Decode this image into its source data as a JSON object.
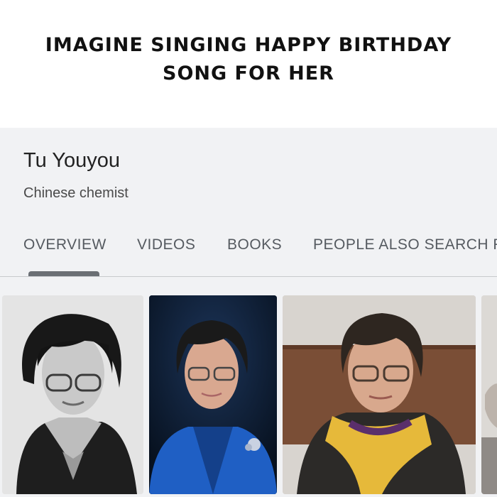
{
  "caption": {
    "line1": "IMAGINE SINGING HAPPY BIRTHDAY",
    "line2": "SONG FOR HER"
  },
  "knowledge_panel": {
    "title": "Tu Youyou",
    "subtitle": "Chinese chemist",
    "tabs": [
      "OVERVIEW",
      "VIDEOS",
      "BOOKS",
      "PEOPLE ALSO SEARCH F"
    ],
    "active_tab": "OVERVIEW"
  },
  "images": [
    {
      "name": "portrait-black-and-white",
      "style": "grayscale"
    },
    {
      "name": "portrait-blue-background",
      "style": "color"
    },
    {
      "name": "portrait-yellow-scarf",
      "style": "color"
    },
    {
      "name": "portrait-partial",
      "style": "color"
    }
  ],
  "colors": {
    "panel_bg": "#f1f2f4",
    "tab_text": "#555a60",
    "indicator": "#6b6f74"
  }
}
